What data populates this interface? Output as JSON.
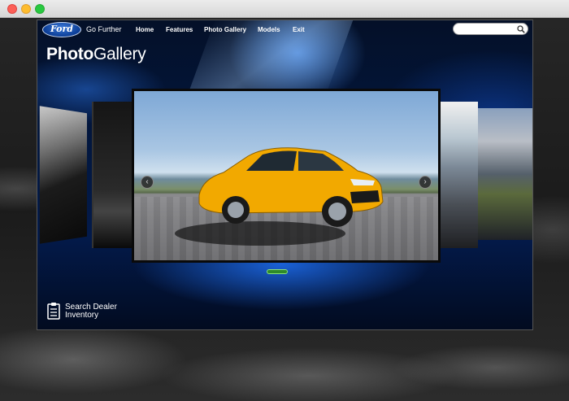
{
  "window": {
    "controls": [
      "close",
      "minimize",
      "maximize"
    ]
  },
  "nav": {
    "brand": "Ford",
    "tagline": "Go Further",
    "links": [
      "Home",
      "Features",
      "Photo Gallery",
      "Models",
      "Exit"
    ],
    "search": {
      "value": "",
      "icon": "search-icon"
    }
  },
  "page": {
    "title_bold": "Photo",
    "title_rest": "Gallery"
  },
  "carousel": {
    "main_image": "Yellow Ford Focus ST driving on road",
    "prev_icon": "chevron-left-icon",
    "next_icon": "chevron-right-icon",
    "arrows": {
      "prev": "‹",
      "next": "›"
    }
  },
  "dealer": {
    "label": "Search Dealer Inventory",
    "icon": "clipboard-icon"
  },
  "colors": {
    "accent": "#1e6ef0",
    "pager": "#2e8a2a",
    "car": "#f2a900"
  }
}
